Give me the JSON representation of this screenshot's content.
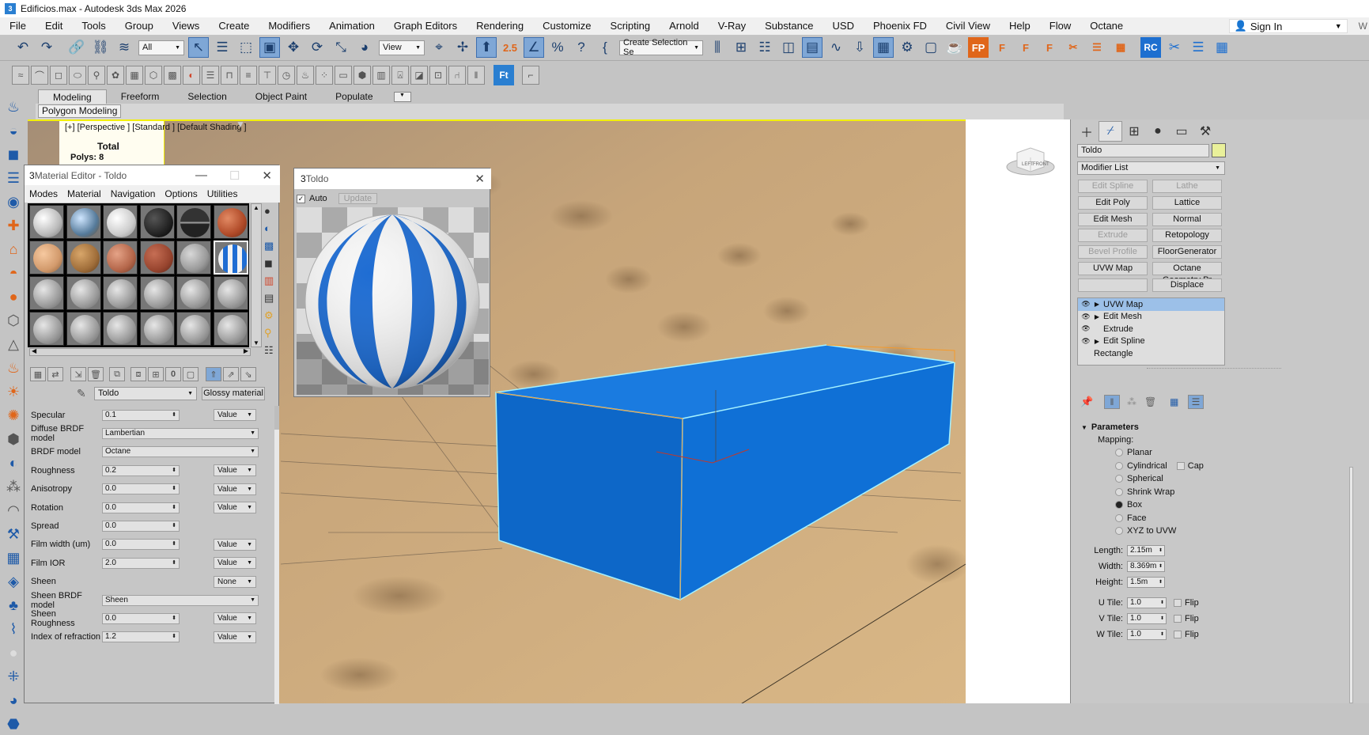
{
  "title": "Edificios.max - Autodesk 3ds Max 2026",
  "menu": [
    "File",
    "Edit",
    "Tools",
    "Group",
    "Views",
    "Create",
    "Modifiers",
    "Animation",
    "Graph Editors",
    "Rendering",
    "Customize",
    "Scripting",
    "Arnold",
    "V-Ray",
    "Substance",
    "USD",
    "Phoenix FD",
    "Civil View",
    "Help",
    "Flow",
    "Octane"
  ],
  "sign_in": "Sign In",
  "toolbar": {
    "filter": "All",
    "ref_coord": "View",
    "snap_label": "2.5",
    "selection_set": "Create Selection Se",
    "fp": "FP",
    "rc": "RC",
    "ft": "Ft"
  },
  "ribbon": {
    "tabs": [
      "Modeling",
      "Freeform",
      "Selection",
      "Object Paint",
      "Populate"
    ],
    "sub": "Polygon Modeling"
  },
  "viewport": {
    "label": "[+] [Perspective ] [Standard ] [Default Shading ]",
    "stats_total": "Total",
    "stats_polys": "Polys:  8",
    "cube_left": "LEFT",
    "cube_front": "FRONT"
  },
  "material_editor": {
    "title": "Material Editor - Toldo",
    "menu": [
      "Modes",
      "Material",
      "Navigation",
      "Options",
      "Utilities"
    ],
    "material_name": "Toldo",
    "material_type": "Glossy material",
    "rows": [
      {
        "label": "Specular",
        "value": "0.1",
        "mode": "Value"
      },
      {
        "label": "Diffuse BRDF model",
        "dropdown": "Lambertian"
      },
      {
        "label": "BRDF model",
        "dropdown": "Octane"
      },
      {
        "label": "Roughness",
        "value": "0.2",
        "mode": "Value"
      },
      {
        "label": "Anisotropy",
        "value": "0.0",
        "mode": "Value"
      },
      {
        "label": "Rotation",
        "value": "0.0",
        "mode": "Value"
      },
      {
        "label": "Spread",
        "value": "0.0",
        "mode": ""
      },
      {
        "label": "Film width (um)",
        "value": "0.0",
        "mode": "Value"
      },
      {
        "label": "Film IOR",
        "value": "2.0",
        "mode": "Value"
      },
      {
        "label": "Sheen",
        "value": "",
        "mode": "None"
      },
      {
        "label": "Sheen BRDF model",
        "dropdown": "Sheen"
      },
      {
        "label": "Sheen Roughness",
        "value": "0.0",
        "mode": "Value"
      },
      {
        "label": "Index of refraction",
        "value": "1.2",
        "mode": "Value"
      }
    ]
  },
  "preview": {
    "title": "Toldo",
    "auto": "Auto",
    "update": "Update"
  },
  "command_panel": {
    "object_name": "Toldo",
    "object_color": "#e9f09a",
    "modifier_list": "Modifier List",
    "buttons": [
      {
        "label": "Edit Spline",
        "disabled": true
      },
      {
        "label": "Lathe",
        "disabled": true
      },
      {
        "label": "Edit Poly",
        "disabled": false
      },
      {
        "label": "Lattice",
        "disabled": false
      },
      {
        "label": "Edit Mesh",
        "disabled": false
      },
      {
        "label": "Normal",
        "disabled": false
      },
      {
        "label": "Extrude",
        "disabled": true
      },
      {
        "label": "Retopology",
        "disabled": false
      },
      {
        "label": "Bevel Profile",
        "disabled": true
      },
      {
        "label": "FloorGenerator",
        "disabled": false
      },
      {
        "label": "UVW Map",
        "disabled": false
      },
      {
        "label": "Octane Geometry Pr",
        "disabled": false
      },
      {
        "label": "",
        "disabled": false
      },
      {
        "label": "Displace",
        "disabled": false
      }
    ],
    "stack": [
      {
        "label": "UVW Map",
        "eye": true,
        "expand": true,
        "selected": true
      },
      {
        "label": "Edit Mesh",
        "eye": true,
        "expand": true,
        "selected": false
      },
      {
        "label": "Extrude",
        "eye": true,
        "expand": false,
        "selected": false
      },
      {
        "label": "Edit Spline",
        "eye": true,
        "expand": true,
        "selected": false
      },
      {
        "label": "Rectangle",
        "eye": false,
        "expand": false,
        "selected": false
      }
    ],
    "params_title": "Parameters",
    "mapping_label": "Mapping:",
    "mapping": [
      "Planar",
      "Cylindrical",
      "Spherical",
      "Shrink Wrap",
      "Box",
      "Face",
      "XYZ to UVW"
    ],
    "mapping_selected": "Box",
    "cap": "Cap",
    "length_label": "Length:",
    "length": "2.15m",
    "width_label": "Width:",
    "width": "8.369m",
    "height_label": "Height:",
    "height": "1.5m",
    "utile_label": "U Tile:",
    "utile": "1.0",
    "vtile_label": "V Tile:",
    "vtile": "1.0",
    "wtile_label": "W Tile:",
    "wtile": "1.0",
    "flip": "Flip"
  },
  "colors": {
    "box_blue": "#0f6fd6",
    "viewport_border": "#f3f000",
    "selection_blue": "#9cc0e8"
  }
}
